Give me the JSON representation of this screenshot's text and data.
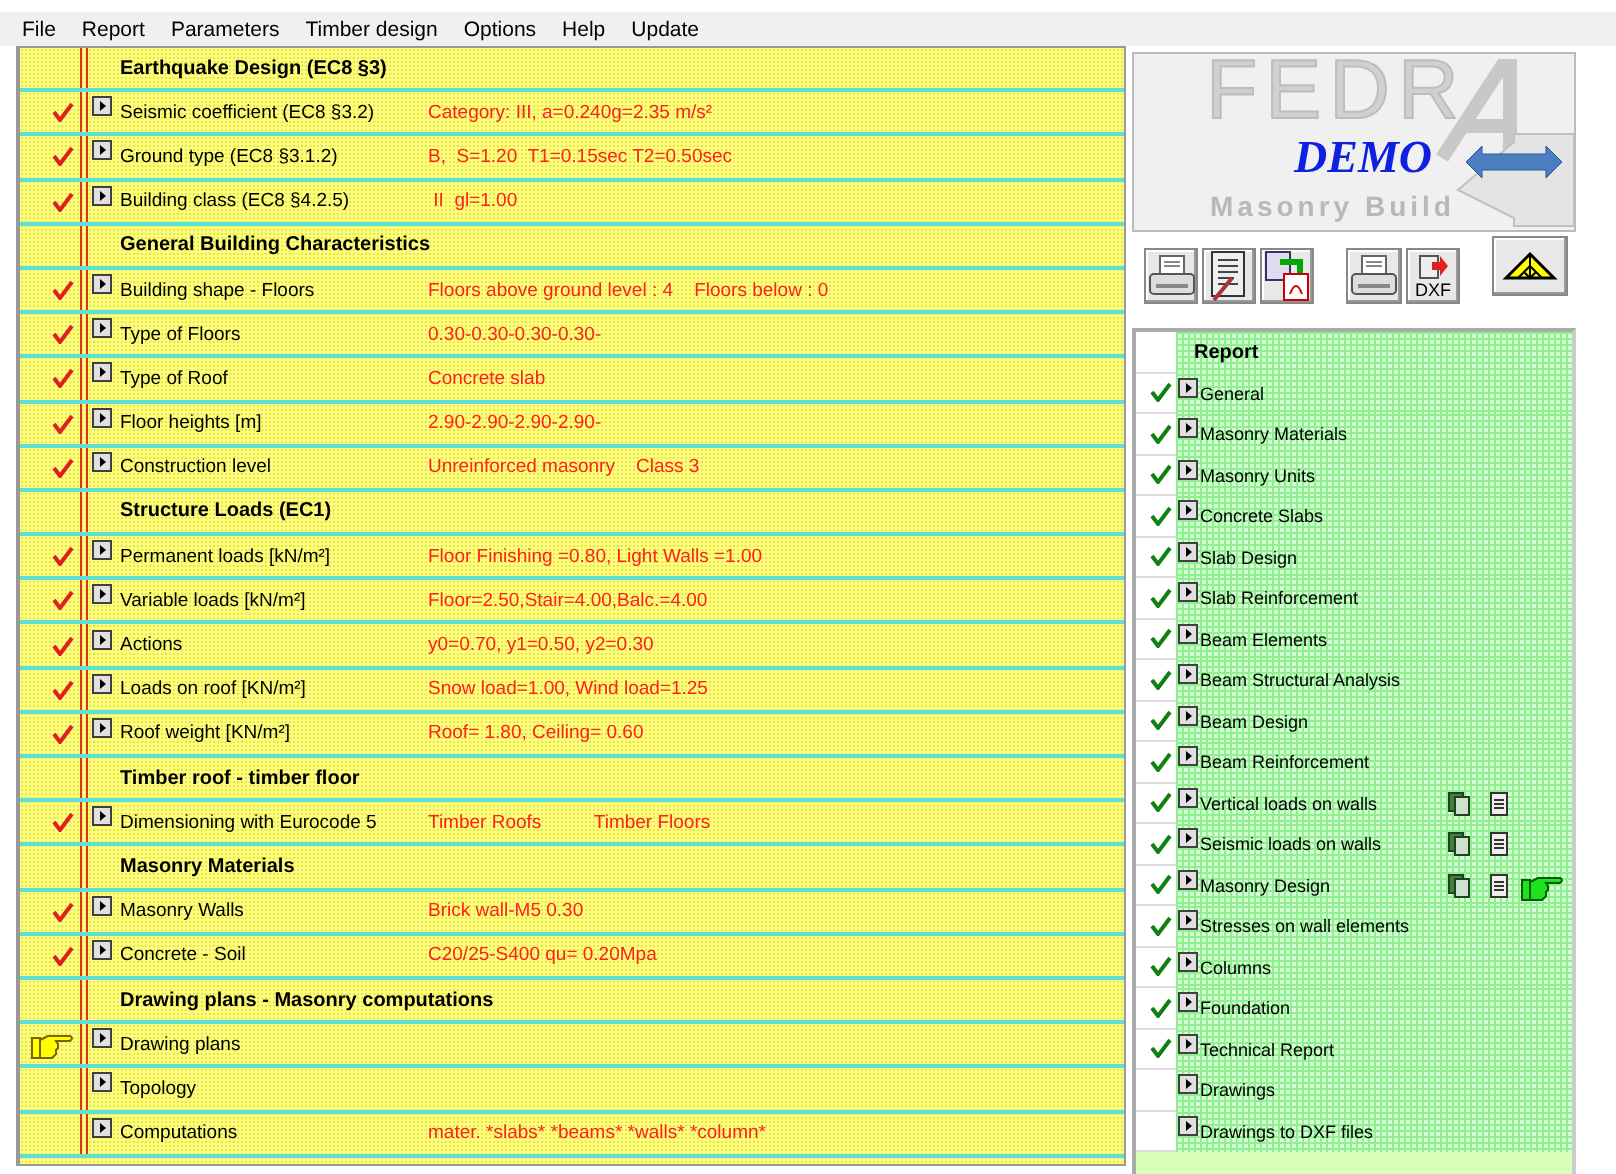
{
  "menu": [
    "File",
    "Report",
    "Parameters",
    "Timber design",
    "Options",
    "Help",
    "Update"
  ],
  "rows": [
    {
      "kind": "header",
      "label": "Earthquake Design (EC8 §3)"
    },
    {
      "kind": "item",
      "label": "Seismic coefficient (EC8 §3.2)",
      "value": "Category: III, a=0.240g=2.35 m/s²",
      "checked": true,
      "current": false
    },
    {
      "kind": "item",
      "label": "Ground type (EC8 §3.1.2)",
      "value": "B,  S=1.20  T1=0.15sec T2=0.50sec",
      "checked": true,
      "current": false
    },
    {
      "kind": "item",
      "label": "Building class (EC8 §4.2.5)",
      "value": " II  gl=1.00",
      "checked": true,
      "current": false
    },
    {
      "kind": "header",
      "label": "General Building Characteristics"
    },
    {
      "kind": "item",
      "label": "Building shape - Floors",
      "value": "Floors above ground level : 4    Floors below : 0",
      "checked": true,
      "current": false
    },
    {
      "kind": "item",
      "label": "Type of Floors",
      "value": "0.30-0.30-0.30-0.30-",
      "checked": true,
      "current": false
    },
    {
      "kind": "item",
      "label": "Type of Roof",
      "value": "Concrete slab",
      "checked": true,
      "current": false
    },
    {
      "kind": "item",
      "label": "Floor heights [m]",
      "value": "2.90-2.90-2.90-2.90-",
      "checked": true,
      "current": false
    },
    {
      "kind": "item",
      "label": "Construction level",
      "value": "Unreinforced masonry    Class 3",
      "checked": true,
      "current": false
    },
    {
      "kind": "header",
      "label": "Structure Loads (EC1)"
    },
    {
      "kind": "item",
      "label": "Permanent loads  [kN/m²]",
      "value": "Floor Finishing =0.80, Light Walls =1.00",
      "checked": true,
      "current": false
    },
    {
      "kind": "item",
      "label": "Variable loads   [kN/m²]",
      "value": "Floor=2.50,Stair=4.00,Balc.=4.00",
      "checked": true,
      "current": false
    },
    {
      "kind": "item",
      "label": "Actions",
      "value": "y0=0.70, y1=0.50, y2=0.30",
      "checked": true,
      "current": false
    },
    {
      "kind": "item",
      "label": "Loads on roof  [KN/m²]",
      "value": "Snow load=1.00, Wind load=1.25",
      "checked": true,
      "current": false
    },
    {
      "kind": "item",
      "label": "Roof weight [KN/m²]",
      "value": "Roof= 1.80, Ceiling= 0.60",
      "checked": true,
      "current": false
    },
    {
      "kind": "header",
      "label": "Timber roof - timber floor"
    },
    {
      "kind": "item",
      "label": "Dimensioning with Eurocode 5",
      "value": "Timber Roofs          Timber Floors",
      "checked": true,
      "current": false
    },
    {
      "kind": "header",
      "label": "Masonry Materials"
    },
    {
      "kind": "item",
      "label": "Masonry Walls",
      "value": "Brick wall-M5 0.30",
      "checked": true,
      "current": false
    },
    {
      "kind": "item",
      "label": "Concrete - Soil",
      "value": "C20/25-S400 qu= 0.20Mpa",
      "checked": true,
      "current": false
    },
    {
      "kind": "header",
      "label": "Drawing plans - Masonry computations"
    },
    {
      "kind": "item",
      "label": "Drawing plans",
      "checked": false,
      "current": true
    },
    {
      "kind": "item",
      "label": "Topology",
      "checked": false,
      "current": false
    },
    {
      "kind": "item",
      "label": "Computations",
      "value": "mater. *slabs* *beams* *walls* *column*",
      "checked": false,
      "current": false
    }
  ],
  "logo": {
    "name": "FEDR",
    "badge": "DEMO",
    "subtitle": "Masonry Build"
  },
  "toolbar": [
    {
      "kind": "print"
    },
    {
      "kind": "report"
    },
    {
      "kind": "pdf"
    },
    {
      "kind": "print"
    },
    {
      "kind": "dxf",
      "label": "DXF"
    },
    {
      "kind": "roof"
    }
  ],
  "report": {
    "title": "Report",
    "items": [
      {
        "label": "General",
        "checked": true,
        "exports": false,
        "current": false
      },
      {
        "label": "Masonry Materials",
        "checked": true,
        "exports": false,
        "current": false
      },
      {
        "label": "Masonry Units",
        "checked": true,
        "exports": false,
        "current": false
      },
      {
        "label": "Concrete Slabs",
        "checked": true,
        "exports": false,
        "current": false
      },
      {
        "label": "Slab Design",
        "checked": true,
        "exports": false,
        "current": false
      },
      {
        "label": "Slab Reinforcement",
        "checked": true,
        "exports": false,
        "current": false
      },
      {
        "label": "Beam Elements",
        "checked": true,
        "exports": false,
        "current": false
      },
      {
        "label": "Beam Structural Analysis",
        "checked": true,
        "exports": false,
        "current": false
      },
      {
        "label": "Beam Design",
        "checked": true,
        "exports": false,
        "current": false
      },
      {
        "label": "Beam Reinforcement",
        "checked": true,
        "exports": false,
        "current": false
      },
      {
        "label": "Vertical loads on walls",
        "checked": true,
        "exports": true,
        "current": false
      },
      {
        "label": "Seismic loads on walls",
        "checked": true,
        "exports": true,
        "current": false
      },
      {
        "label": "Masonry Design",
        "checked": true,
        "exports": true,
        "current": true
      },
      {
        "label": "Stresses on wall elements",
        "checked": true,
        "exports": false,
        "current": false
      },
      {
        "label": "Columns",
        "checked": true,
        "exports": false,
        "current": false
      },
      {
        "label": "Foundation",
        "checked": true,
        "exports": false,
        "current": false
      },
      {
        "label": "Technical Report",
        "checked": true,
        "exports": false,
        "current": false
      },
      {
        "label": "Drawings",
        "checked": false,
        "exports": false,
        "current": false
      },
      {
        "label": "Drawings to DXF files",
        "checked": false,
        "exports": false,
        "current": false
      }
    ]
  }
}
